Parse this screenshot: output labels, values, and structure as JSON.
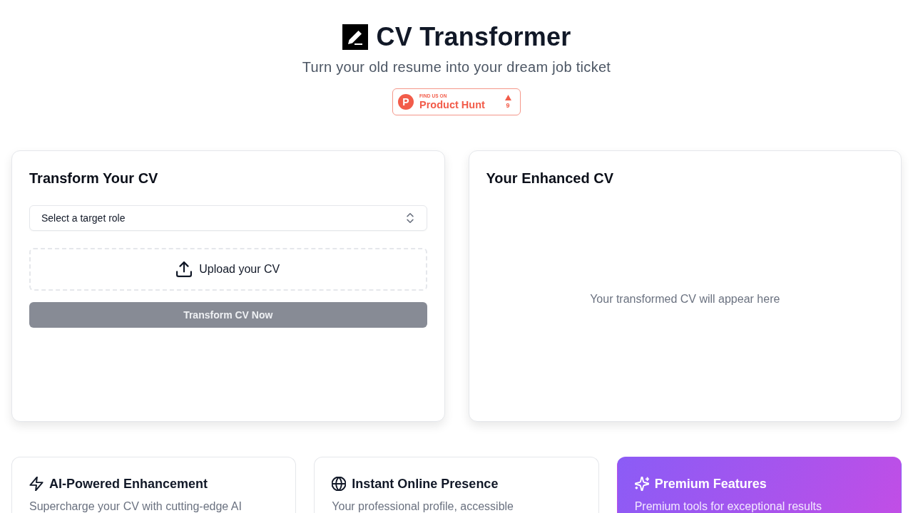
{
  "header": {
    "title": "CV Transformer",
    "subtitle": "Turn your old resume into your dream job ticket",
    "badge": {
      "logo": "P",
      "caption": "FIND US ON",
      "name": "Product Hunt",
      "count": "9"
    }
  },
  "transform_panel": {
    "title": "Transform Your CV",
    "role_select": {
      "placeholder": "Select a target role"
    },
    "upload": {
      "label": "Upload your CV"
    },
    "button": {
      "label": "Transform CV Now",
      "disabled": true
    }
  },
  "result_panel": {
    "title": "Your Enhanced CV",
    "placeholder": "Your transformed CV will appear here"
  },
  "features": [
    {
      "kind": "lightning",
      "title": "AI-Powered Enhancement",
      "description": "Supercharge your CV with cutting-edge AI",
      "highlighted": false
    },
    {
      "kind": "globe",
      "title": "Instant Online Presence",
      "description": "Your professional profile, accessible",
      "highlighted": false
    },
    {
      "kind": "sparkles",
      "title": "Premium Features",
      "description": "Premium tools for exceptional results",
      "highlighted": true
    }
  ]
}
